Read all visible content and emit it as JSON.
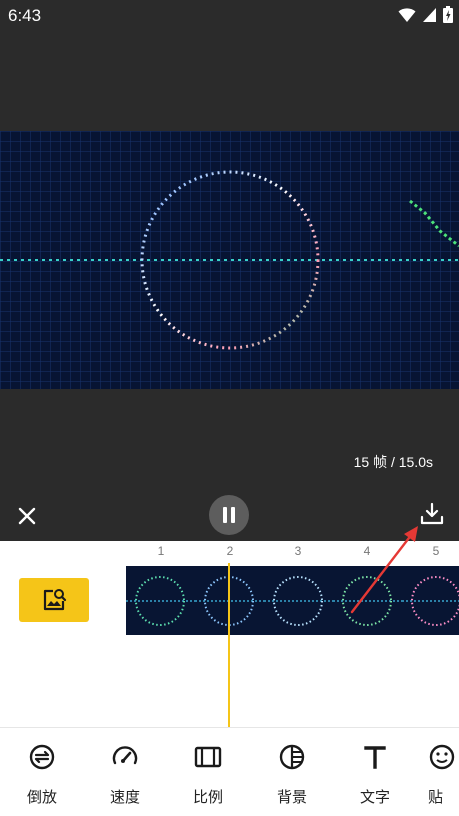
{
  "status_bar": {
    "time": "6:43"
  },
  "preview": {
    "frame_info": "15 帧 / 15.0s"
  },
  "timeline": {
    "ruler_ticks": [
      "1",
      "2",
      "3",
      "4",
      "5"
    ]
  },
  "toolbar": {
    "tools": [
      {
        "label": "倒放",
        "icon": "reverse-icon"
      },
      {
        "label": "速度",
        "icon": "speed-gauge-icon"
      },
      {
        "label": "比例",
        "icon": "aspect-ratio-icon"
      },
      {
        "label": "背景",
        "icon": "background-icon"
      },
      {
        "label": "文字",
        "icon": "text-icon"
      },
      {
        "label": "贴",
        "icon": "sticker-icon"
      }
    ]
  },
  "colors": {
    "accent": "#f5c518",
    "dark_bg": "#2b2b2b",
    "annotation": "#e53935"
  }
}
